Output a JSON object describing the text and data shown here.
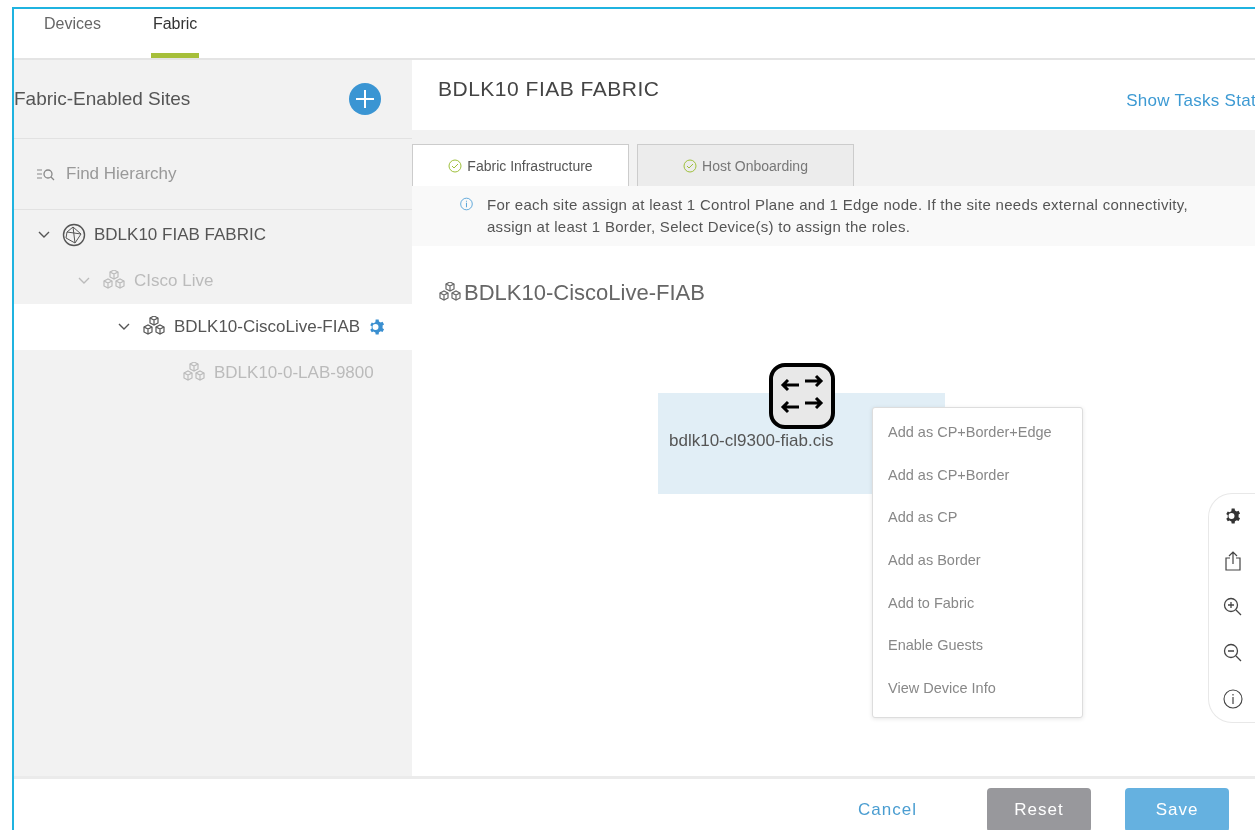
{
  "top_tabs": [
    {
      "label": "Devices",
      "selected": false
    },
    {
      "label": "Fabric",
      "selected": true
    }
  ],
  "sidebar": {
    "title": "Fabric-Enabled Sites",
    "search": {
      "placeholder": "Find Hierarchy"
    },
    "tree": [
      {
        "label": "BDLK10 FIAB FABRIC",
        "kind": "fabric",
        "expanded": true,
        "dimmed": false,
        "selected": false,
        "children": [
          {
            "label": "CIsco Live",
            "kind": "site",
            "expanded": true,
            "dimmed": true,
            "selected": false,
            "children": [
              {
                "label": "BDLK10-CiscoLive-FIAB",
                "kind": "site",
                "expanded": true,
                "dimmed": false,
                "selected": true,
                "children": [
                  {
                    "label": "BDLK10-0-LAB-9800",
                    "kind": "site",
                    "dimmed": true,
                    "selected": false
                  }
                ]
              }
            ]
          }
        ]
      }
    ]
  },
  "main": {
    "title": "BDLK10 FIAB FABRIC",
    "link": "Show Tasks Stat",
    "tabs": [
      {
        "label": "Fabric Infrastructure",
        "selected": true
      },
      {
        "label": "Host Onboarding",
        "selected": false
      }
    ],
    "info": "For each site assign at least 1 Control Plane and 1 Edge node. If the site needs external connectivity, assign at least 1 Border, Select Device(s) to assign the roles.",
    "site_title": "BDLK10-CiscoLive-FIAB",
    "device": {
      "label": "bdlk10-cl9300-fiab.cis",
      "selected": true
    },
    "context_menu": [
      "Add as CP+Border+Edge",
      "Add as CP+Border",
      "Add as CP",
      "Add as Border",
      "Add to Fabric",
      "Enable Guests",
      "View Device Info"
    ]
  },
  "footer": {
    "buttons": [
      {
        "label": "Cancel",
        "kind": "link"
      },
      {
        "label": "Reset",
        "kind": "secondary"
      },
      {
        "label": "Save",
        "kind": "primary"
      }
    ]
  }
}
